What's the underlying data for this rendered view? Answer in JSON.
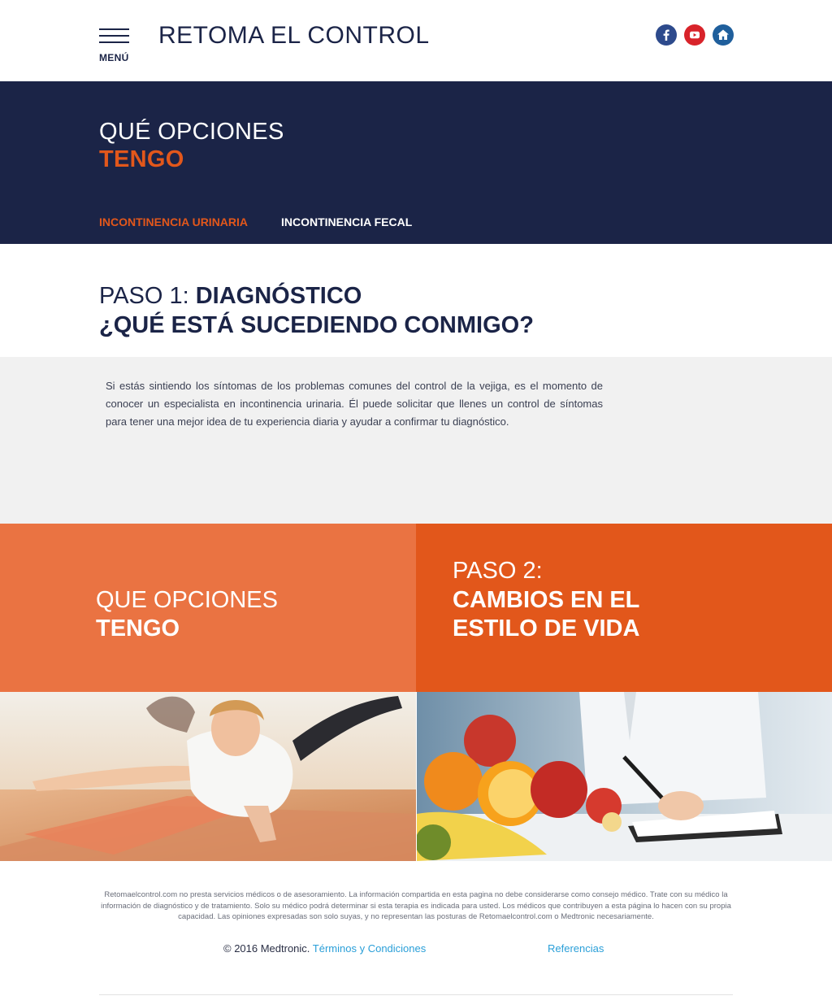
{
  "header": {
    "menu_label": "MENÚ",
    "title": "RETOMA EL CONTROL",
    "social": [
      {
        "name": "facebook",
        "icon": "facebook-icon"
      },
      {
        "name": "youtube",
        "icon": "youtube-icon"
      },
      {
        "name": "home",
        "icon": "home-icon"
      }
    ]
  },
  "hero": {
    "title_line1": "QUÉ OPCIONES",
    "title_line2": "TENGO",
    "tabs": [
      {
        "label": "INCONTINENCIA URINARIA",
        "active": true
      },
      {
        "label": "INCONTINENCIA FECAL",
        "active": false
      }
    ]
  },
  "step1": {
    "prefix": "PASO 1: ",
    "title": "DIAGNÓSTICO",
    "question": "¿QUÉ ESTÁ SUCEDIENDO CONMIGO?",
    "body": "Si estás sintiendo los síntomas de los problemas comunes del control de la vejiga, es el momento de conocer un especialista en incontinencia urinaria. Él puede solicitar que llenes un control de síntomas para tener una mejor idea de tu experiencia diaria y ayudar a confirmar tu diagnóstico."
  },
  "tiles": {
    "left": {
      "line1": "QUE OPCIONES",
      "line2": "TENGO"
    },
    "right": {
      "line1": "PASO 2:",
      "line2": "CAMBIOS EN EL",
      "line3": "ESTILO DE VIDA"
    }
  },
  "footer": {
    "disclaimer": "Retomaelcontrol.com no presta servicios médicos o de asesoramiento. La información compartida en esta pagina no debe considerarse como consejo médico. Trate con su médico la información de diagnóstico y de tratamiento. Solo su médico podrá determinar si esta terapia es indicada para usted. Los médicos que contribuyen a esta página lo hacen con su propia capacidad. Las opiniones expresadas son solo suyas, y no representan las posturas de Retomaelcontrol.com o Medtronic necesariamente.",
    "copyright": "© 2016 Medtronic. ",
    "terms_link": "Términos y Condiciones",
    "references_link": "Referencias"
  },
  "colors": {
    "navy": "#1b2447",
    "orange": "#e2571b",
    "orange_light": "#ea7342",
    "grey_panel": "#f1f1f1",
    "link": "#2a9fd8"
  }
}
